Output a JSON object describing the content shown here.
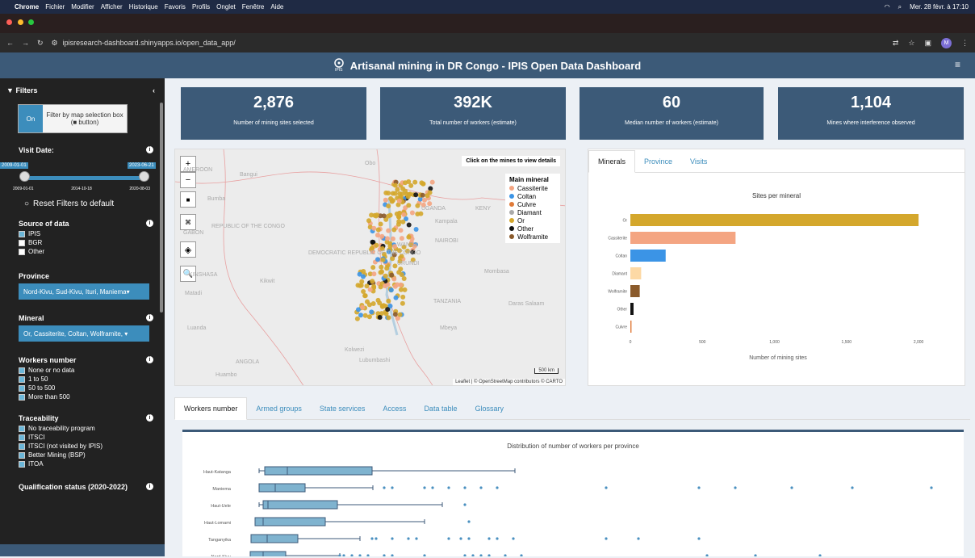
{
  "mac": {
    "menu": [
      "Chrome",
      "Fichier",
      "Modifier",
      "Afficher",
      "Historique",
      "Favoris",
      "Profils",
      "Onglet",
      "Fenêtre",
      "Aide"
    ],
    "datetime": "Mer. 28 févr. à 17:10"
  },
  "browser": {
    "url": "ipisresearch-dashboard.shinyapps.io/open_data_app/",
    "avatar": "M"
  },
  "header": {
    "title": "Artisanal mining in DR Congo - IPIS Open Data Dashboard",
    "logo_text": "IPIS"
  },
  "sidebar": {
    "title": "Filters",
    "toggle_on": "On",
    "toggle_label": "Filter by map selection box (■ button)",
    "visit_date": {
      "label": "Visit Date:",
      "from": "2009-01-01",
      "to": "2023-06-21",
      "ticks": [
        "2009-01-01",
        "2014-10-18",
        "2020-08-03"
      ]
    },
    "reset": "Reset Filters to default",
    "source": {
      "label": "Source of data",
      "items": [
        {
          "label": "IPIS",
          "checked": true
        },
        {
          "label": "BGR",
          "checked": false
        },
        {
          "label": "Other",
          "checked": false
        }
      ]
    },
    "province": {
      "label": "Province",
      "value": "Nord-Kivu, Sud-Kivu, Ituri, Maniema"
    },
    "mineral": {
      "label": "Mineral",
      "value": "Or, Cassiterite, Coltan, Wolframite,"
    },
    "workers": {
      "label": "Workers number",
      "items": [
        "None or no data",
        "1 to 50",
        "50 to 500",
        "More than 500"
      ]
    },
    "traceability": {
      "label": "Traceability",
      "items": [
        "No traceability program",
        "ITSCI",
        "ITSCI (not visited by IPIS)",
        "Better Mining (BSP)",
        "ITOA"
      ]
    },
    "qualification": {
      "label": "Qualification status (2020-2022)"
    }
  },
  "kpis": [
    {
      "value": "2,876",
      "label": "Number of mining sites selected"
    },
    {
      "value": "392K",
      "label": "Total number of workers (estimate)"
    },
    {
      "value": "60",
      "label": "Median number of workers (estimate)"
    },
    {
      "value": "1,104",
      "label": "Mines where interference observed"
    }
  ],
  "map": {
    "note": "Click on the mines to view details",
    "legend_title": "Main mineral",
    "legend": [
      {
        "label": "Cassiterite",
        "color": "#f4a582"
      },
      {
        "label": "Coltan",
        "color": "#3b94e6"
      },
      {
        "label": "Culvre",
        "color": "#e07b39"
      },
      {
        "label": "Diamant",
        "color": "#aaaaaa"
      },
      {
        "label": "Or",
        "color": "#d4a72c"
      },
      {
        "label": "Other",
        "color": "#111111"
      },
      {
        "label": "Wolframite",
        "color": "#8a5a2b"
      }
    ],
    "labels": [
      "AMEROON",
      "Bangui",
      "Bumba",
      "UGANDA",
      "KENY",
      "Kampala",
      "REPUBLIC OF THE CONGO",
      "GABON",
      "DEMOCRATIC REPUBLIC OF THE CONGO",
      "WANDA",
      "NAIROBI",
      "URUNDI",
      "Mombasa",
      "KINSHASA",
      "Kikwit",
      "Matadi",
      "TANZANIA",
      "Daras Salaam",
      "Luanda",
      "Mbeya",
      "Kolwezi",
      "ANGOLA",
      "Lubumbashi",
      "Huambo",
      "Obo"
    ],
    "scale": "500 km",
    "attribution": "Leaflet | © OpenStreetMap contributors © CARTO"
  },
  "right_tabs": [
    "Minerals",
    "Province",
    "Visits"
  ],
  "chart_data": [
    {
      "type": "bar",
      "title": "Sites per mineral",
      "xlabel": "Number of mining sites",
      "categories": [
        "Or",
        "Cassiterite",
        "Coltan",
        "Diamant",
        "Wolframite",
        "Other",
        "Culvre"
      ],
      "values": [
        2000,
        730,
        245,
        75,
        65,
        22,
        8
      ],
      "colors": [
        "#d4a72c",
        "#f4a582",
        "#3b94e6",
        "#fdd9a5",
        "#8a5a2b",
        "#111111",
        "#e07b39"
      ],
      "xlim": [
        0,
        2050
      ],
      "xticks": [
        "0",
        "500",
        "1,000",
        "1,500",
        "2,000"
      ]
    },
    {
      "type": "box",
      "title": "Distribution of number of workers per province",
      "categories": [
        "Haut-Katanga",
        "Maniema",
        "Haut-Uele",
        "Haut-Lomami",
        "Tanganyika",
        "Nord-Kivu"
      ]
    }
  ],
  "bottom_tabs": [
    "Workers number",
    "Armed groups",
    "State services",
    "Access",
    "Data table",
    "Glossary"
  ]
}
